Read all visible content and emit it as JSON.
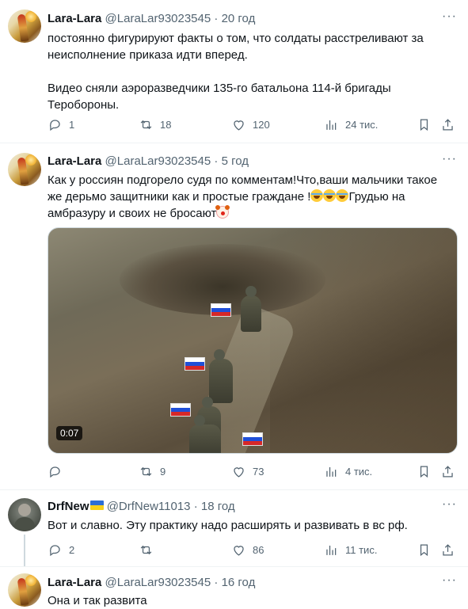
{
  "tweets": [
    {
      "name": "Lara-Lara",
      "handle": "@LaraLar93023545",
      "time": "20 год",
      "text_lines": [
        "постоянно фигурируют факты о том, что солдаты расстреливают за",
        "неисполнение приказа идти вперед.",
        "",
        "Видео сняли аэроразведчики 135-го батальона 114-й бригады",
        "Теробороны."
      ],
      "replies": "1",
      "reposts": "18",
      "likes": "120",
      "views": "24 тис."
    },
    {
      "name": "Lara-Lara",
      "handle": "@LaraLar93023545",
      "time": "5 год",
      "text_line1": "Как у россиян подгорело судя по комментам!Что,ваши мальчики такое",
      "text_line2": "же дерьмо защитники как и простые граждане !",
      "text_line2b": "Грудью на",
      "text_line3": "амбразуру и своих не бросают",
      "video_duration": "0:07",
      "replies": "",
      "reposts": "9",
      "likes": "73",
      "views": "4 тис."
    },
    {
      "name": "DrfNew",
      "handle": "@DrfNew11013",
      "time": "18 год",
      "text": "Вот и славно. Эту практику надо расширять и развивать в вс рф.",
      "replies": "2",
      "reposts": "",
      "likes": "86",
      "views": "11 тис."
    },
    {
      "name": "Lara-Lara",
      "handle": "@LaraLar93023545",
      "time": "16 год",
      "text": "Она и так развита"
    }
  ],
  "separator": "·",
  "icons": {
    "reply": "reply-icon",
    "repost": "repost-icon",
    "like": "heart-icon",
    "views": "views-icon",
    "bookmark": "bookmark-icon",
    "share": "share-icon",
    "more": "more-icon"
  }
}
